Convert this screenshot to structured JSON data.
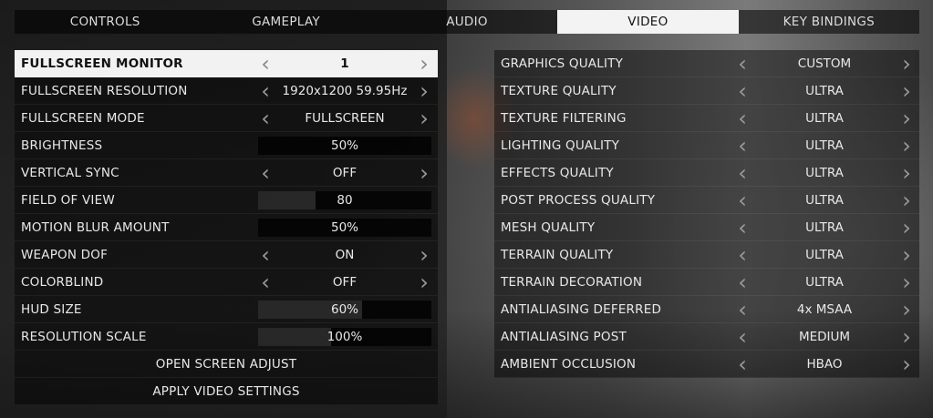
{
  "tabs": [
    {
      "label": "CONTROLS",
      "active": false
    },
    {
      "label": "GAMEPLAY",
      "active": false
    },
    {
      "label": "AUDIO",
      "active": false
    },
    {
      "label": "VIDEO",
      "active": true
    },
    {
      "label": "KEY BINDINGS",
      "active": false
    }
  ],
  "left": {
    "rows": [
      {
        "label": "FULLSCREEN MONITOR",
        "value": "1",
        "kind": "select",
        "selected": true
      },
      {
        "label": "FULLSCREEN RESOLUTION",
        "value": "1920x1200 59.95Hz",
        "kind": "select"
      },
      {
        "label": "FULLSCREEN MODE",
        "value": "FULLSCREEN",
        "kind": "select"
      },
      {
        "label": "BRIGHTNESS",
        "value": "50%",
        "kind": "slider",
        "level": 0.0
      },
      {
        "label": "VERTICAL SYNC",
        "value": "OFF",
        "kind": "select"
      },
      {
        "label": "FIELD OF VIEW",
        "value": "80",
        "kind": "slider",
        "level": 0.33
      },
      {
        "label": "MOTION BLUR AMOUNT",
        "value": "50%",
        "kind": "slider",
        "level": 0.0
      },
      {
        "label": "WEAPON DOF",
        "value": "ON",
        "kind": "select"
      },
      {
        "label": "COLORBLIND",
        "value": "OFF",
        "kind": "select"
      },
      {
        "label": "HUD SIZE",
        "value": "60%",
        "kind": "slider",
        "level": 0.6
      },
      {
        "label": "RESOLUTION SCALE",
        "value": "100%",
        "kind": "slider",
        "level": 0.42
      }
    ],
    "actions": [
      {
        "label": "OPEN SCREEN ADJUST"
      },
      {
        "label": "APPLY VIDEO SETTINGS"
      }
    ]
  },
  "right": {
    "rows": [
      {
        "label": "GRAPHICS QUALITY",
        "value": "CUSTOM"
      },
      {
        "label": "TEXTURE QUALITY",
        "value": "ULTRA"
      },
      {
        "label": "TEXTURE FILTERING",
        "value": "ULTRA"
      },
      {
        "label": "LIGHTING QUALITY",
        "value": "ULTRA"
      },
      {
        "label": "EFFECTS QUALITY",
        "value": "ULTRA"
      },
      {
        "label": "POST PROCESS QUALITY",
        "value": "ULTRA"
      },
      {
        "label": "MESH QUALITY",
        "value": "ULTRA"
      },
      {
        "label": "TERRAIN QUALITY",
        "value": "ULTRA"
      },
      {
        "label": "TERRAIN DECORATION",
        "value": "ULTRA"
      },
      {
        "label": "ANTIALIASING DEFERRED",
        "value": "4x MSAA"
      },
      {
        "label": "ANTIALIASING POST",
        "value": "MEDIUM"
      },
      {
        "label": "AMBIENT OCCLUSION",
        "value": "HBAO"
      }
    ]
  },
  "icons": {
    "prev": "chevron-left-icon",
    "next": "chevron-right-icon"
  }
}
